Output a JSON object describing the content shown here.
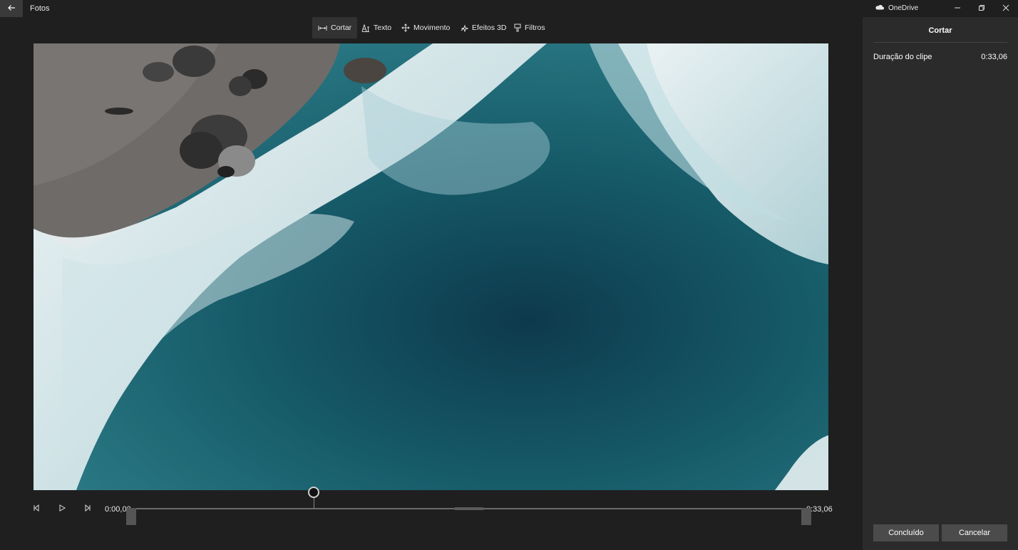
{
  "app": {
    "title": "Fotos"
  },
  "toolbar": {
    "items": [
      {
        "label": "Cortar",
        "icon": "trim-icon",
        "active": true
      },
      {
        "label": "Texto",
        "icon": "text-icon",
        "active": false
      },
      {
        "label": "Movimento",
        "icon": "motion-icon",
        "active": false
      },
      {
        "label": "Efeitos 3D",
        "icon": "3d-effects-icon",
        "active": false
      },
      {
        "label": "Filtros",
        "icon": "filter-icon",
        "active": false
      }
    ]
  },
  "window": {
    "onedrive_label": "OneDrive"
  },
  "timeline": {
    "start_time": "0:00,00",
    "end_time": "0:33,06",
    "playhead_fraction": 0.27
  },
  "panel": {
    "title": "Cortar",
    "duration_label": "Duração do clipe",
    "duration_value": "0:33,06",
    "done_label": "Concluído",
    "cancel_label": "Cancelar"
  },
  "colors": {
    "background": "#1f1f1f",
    "panel": "#2b2b2b",
    "button": "#4b4b4b"
  }
}
